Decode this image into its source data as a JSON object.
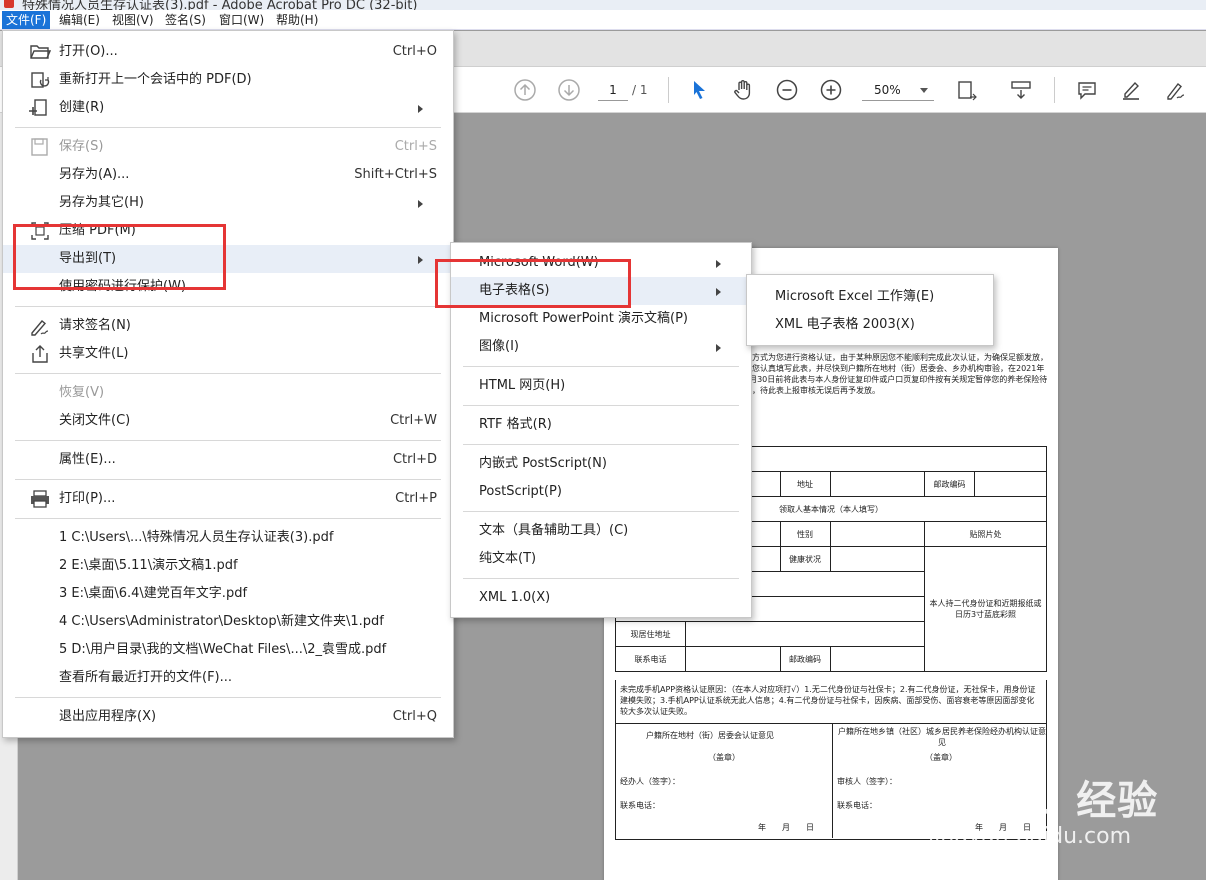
{
  "window": {
    "title": "特殊情况人员生存认证表(3).pdf - Adobe Acrobat Pro DC (32-bit)"
  },
  "menubar": [
    "文件(F)",
    "编辑(E)",
    "视图(V)",
    "签名(S)",
    "窗口(W)",
    "帮助(H)"
  ],
  "toolbar": {
    "page_current": "1",
    "page_total": "/ 1",
    "zoom": "50%"
  },
  "file_menu": {
    "items": [
      {
        "label": "打开(O)...",
        "shortcut": "Ctrl+O",
        "icon": "open-folder-icon"
      },
      {
        "label": "重新打开上一个会话中的 PDF(D)",
        "shortcut": "",
        "icon": "reopen-icon"
      },
      {
        "label": "创建(R)",
        "shortcut": "",
        "icon": "create-icon",
        "submenu": true
      },
      {
        "label": "保存(S)",
        "shortcut": "Ctrl+S",
        "icon": "save-icon",
        "disabled": true
      },
      {
        "label": "另存为(A)...",
        "shortcut": "Shift+Ctrl+S"
      },
      {
        "label": "另存为其它(H)",
        "shortcut": "",
        "submenu": true
      },
      {
        "label": "压缩 PDF(M)",
        "shortcut": "",
        "icon": "compress-icon"
      },
      {
        "label": "导出到(T)",
        "shortcut": "",
        "submenu": true,
        "highlighted": true
      },
      {
        "label": "使用密码进行保护(W)",
        "shortcut": ""
      },
      {
        "label": "请求签名(N)",
        "shortcut": "",
        "icon": "sign-icon"
      },
      {
        "label": "共享文件(L)",
        "shortcut": "",
        "icon": "share-icon"
      },
      {
        "label": "恢复(V)",
        "shortcut": "",
        "disabled": true
      },
      {
        "label": "关闭文件(C)",
        "shortcut": "Ctrl+W"
      },
      {
        "label": "属性(E)...",
        "shortcut": "Ctrl+D"
      },
      {
        "label": "打印(P)...",
        "shortcut": "Ctrl+P",
        "icon": "printer-icon"
      },
      {
        "label": "1 C:\\Users\\...\\特殊情况人员生存认证表(3).pdf",
        "shortcut": ""
      },
      {
        "label": "2 E:\\桌面\\5.11\\演示文稿1.pdf",
        "shortcut": ""
      },
      {
        "label": "3 E:\\桌面\\6.4\\建党百年文字.pdf",
        "shortcut": ""
      },
      {
        "label": "4 C:\\Users\\Administrator\\Desktop\\新建文件夹\\1.pdf",
        "shortcut": ""
      },
      {
        "label": "5 D:\\用户目录\\我的文档\\WeChat Files\\...\\2_袁雪成.pdf",
        "shortcut": ""
      },
      {
        "label": "查看所有最近打开的文件(F)...",
        "shortcut": ""
      },
      {
        "label": "退出应用程序(X)",
        "shortcut": "Ctrl+Q"
      }
    ]
  },
  "export_menu": {
    "items": [
      {
        "label": "Microsoft Word(W)",
        "submenu": true
      },
      {
        "label": "电子表格(S)",
        "submenu": true,
        "highlighted": true
      },
      {
        "label": "Microsoft PowerPoint 演示文稿(P)"
      },
      {
        "label": "图像(I)",
        "submenu": true
      },
      {
        "label": "HTML 网页(H)"
      },
      {
        "label": "RTF 格式(R)"
      },
      {
        "label": "内嵌式 PostScript(N)"
      },
      {
        "label": "PostScript(P)"
      },
      {
        "label": "文本（具备辅助工具）(C)"
      },
      {
        "label": "纯文本(T)"
      },
      {
        "label": "XML 1.0(X)"
      }
    ]
  },
  "spreadsheet_menu": {
    "items": [
      {
        "label": "Microsoft Excel 工作簿(E)"
      },
      {
        "label": "XML 电子表格 2003(X)"
      }
    ]
  },
  "document": {
    "intro": "别方式为您进行资格认证，由于某种原因您不能顺利完成此次认证，为确保足额发放，请您认真填写此表，并尽快到户籍所在地村（街）居委会、乡办机构审验，在2021年9月30日前将此表与本人身份证复印件或户口页复印件按有关规定暂停您的养老保险待遇，待此表上报审核无误后再予发放。",
    "labels": {
      "address": "地址",
      "postcode": "邮政编码",
      "applicant_info": "领取人基本情况（本人填写）",
      "gender": "性别",
      "photo": "贴照片处",
      "health": "健康状况",
      "photo_note": "本人持二代身份证和近期报纸或日历3寸蓝底彩照",
      "current_address": "现居住地址",
      "contact_phone": "联系电话",
      "postcode2": "邮政编码"
    },
    "reason": "未完成手机APP资格认证原因：（在本人对应项打√）1.无二代身份证与社保卡；2.有二代身份证，无社保卡，用身份证建模失败；3.手机APP认证系统无此人信息；4.有二代身份证与社保卡，因疾病、面部受伤、面容衰老等原因面部变化较大多次认证失败。",
    "left_col": {
      "title": "户籍所在地村（街）居委会认证意见",
      "seal": "（盖章）",
      "handler": "经办人（签字）：",
      "phone": "联系电话：",
      "date": "年　　月　　日"
    },
    "right_col": {
      "title": "户籍所在地乡镇（社区）城乡居民养老保险经办机构认证意见",
      "seal": "（盖章）",
      "reviewer": "审核人（签字）：",
      "phone": "联系电话：",
      "date": "年　　月　　日"
    }
  },
  "watermark": {
    "brand": "Baidu 经验",
    "url": "jingyan.baidu.com"
  },
  "colors": {
    "menu_active": "#1a73d8",
    "highlight_box": "#e53535",
    "select_tool": "#1a73d8"
  }
}
